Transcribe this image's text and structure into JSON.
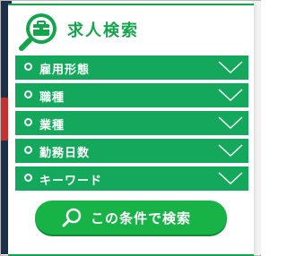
{
  "header": {
    "title": "求人検索",
    "icon": "job-search-icon"
  },
  "filters": [
    {
      "label": "雇用形態",
      "icon": "chevron-down-icon"
    },
    {
      "label": "職種",
      "icon": "chevron-down-icon"
    },
    {
      "label": "業種",
      "icon": "chevron-down-icon"
    },
    {
      "label": "勤務日数",
      "icon": "chevron-down-icon"
    },
    {
      "label": "キーワード",
      "icon": "chevron-down-icon"
    }
  ],
  "search_button": {
    "label": "この条件で検索",
    "icon": "search-icon"
  },
  "colors": {
    "accent": "#13a54c",
    "row_bg": "#13a85b",
    "button_bg": "#17b346"
  }
}
